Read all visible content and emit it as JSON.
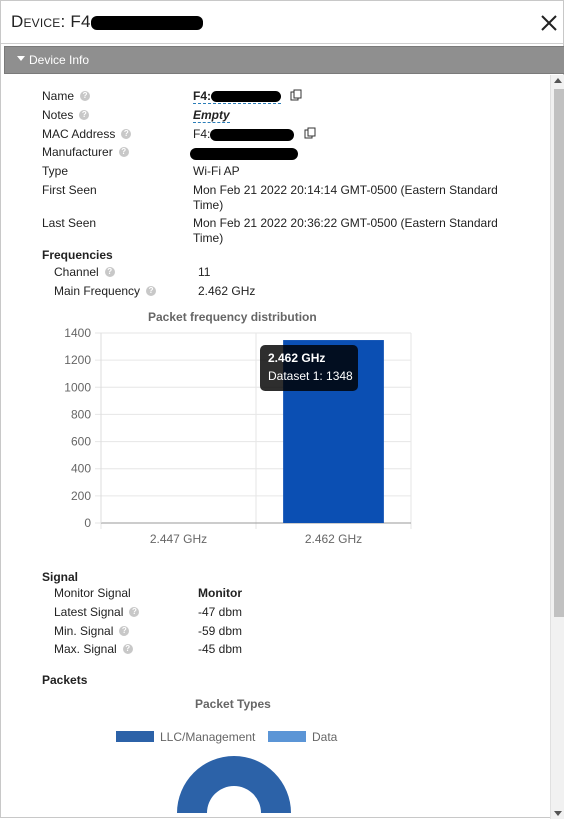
{
  "dialog": {
    "title_prefix": "Device",
    "title_sep": ": ",
    "title_visible": "F4"
  },
  "accordion": {
    "label": "Device Info"
  },
  "device": {
    "name_label": "Name",
    "name_value": "F4:",
    "notes_label": "Notes",
    "notes_value": "Empty",
    "mac_label": "MAC Address",
    "mac_value": "F4:",
    "manufacturer_label": "Manufacturer",
    "type_label": "Type",
    "type_value": "Wi-Fi AP",
    "first_seen_label": "First Seen",
    "first_seen_line1": "Mon Feb 21 2022 20:14:14 GMT-0500 (Eastern Standard",
    "first_seen_line2": "Time)",
    "last_seen_label": "Last Seen",
    "last_seen_line1": "Mon Feb 21 2022 20:36:22 GMT-0500 (Eastern Standard",
    "last_seen_line2": "Time)"
  },
  "frequencies": {
    "heading": "Frequencies",
    "channel_label": "Channel",
    "channel_value": "11",
    "main_freq_label": "Main Frequency",
    "main_freq_value": "2.462 GHz"
  },
  "chart_data": {
    "type": "bar",
    "title": "Packet frequency distribution",
    "categories": [
      "2.447 GHz",
      "2.462 GHz"
    ],
    "series": [
      {
        "name": "Dataset 1",
        "values": [
          0,
          1348
        ]
      }
    ],
    "ylim": [
      0,
      1400
    ],
    "yticks": [
      0,
      200,
      400,
      600,
      800,
      1000,
      1200,
      1400
    ],
    "bar_color": "#0b4fb3",
    "grid": true,
    "tooltip": {
      "title": "2.462 GHz",
      "body": "Dataset 1: 1348"
    }
  },
  "signal": {
    "heading": "Signal",
    "monitor_label": "Monitor Signal",
    "monitor_value": "Monitor",
    "latest_label": "Latest Signal",
    "latest_value": "-47 dbm",
    "min_label": "Min. Signal",
    "min_value": "-59 dbm",
    "max_label": "Max. Signal",
    "max_value": "-45 dbm"
  },
  "packets": {
    "heading": "Packets",
    "chart_title": "Packet Types",
    "legend": [
      {
        "name": "LLC/Management",
        "color": "#2c62a8"
      },
      {
        "name": "Data",
        "color": "#5b95d6"
      }
    ]
  },
  "icons": {
    "close": "close-icon",
    "help": "help-icon",
    "copy": "copy-icon",
    "caret": "caret-down-icon"
  }
}
